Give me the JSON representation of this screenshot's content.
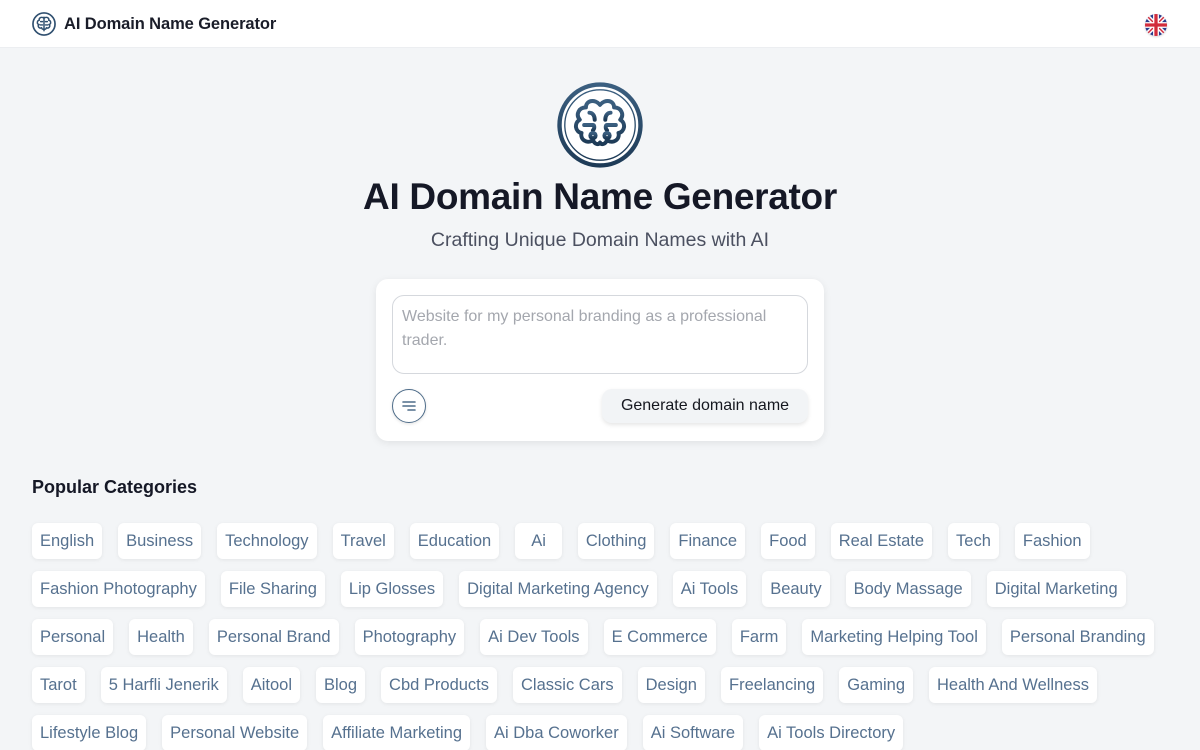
{
  "header": {
    "brand_title": "AI Domain Name Generator",
    "brand_icon": "brain-logo-icon",
    "language_icon": "uk-flag-icon"
  },
  "hero": {
    "logo_icon": "brain-logo-icon",
    "title": "AI Domain Name Generator",
    "subtitle": "Crafting Unique Domain Names with AI"
  },
  "generator": {
    "prompt_value": "",
    "prompt_placeholder": "Website for my personal branding as a professional trader.",
    "options_icon": "filter-lines-icon",
    "generate_label": "Generate domain name"
  },
  "categories": {
    "title": "Popular Categories",
    "items": [
      "English",
      "Business",
      "Technology",
      "Travel",
      "Education",
      "Ai",
      "Clothing",
      "Finance",
      "Food",
      "Real Estate",
      "Tech",
      "Fashion",
      "Fashion Photography",
      "File Sharing",
      "Lip Glosses",
      "Digital Marketing Agency",
      "Ai Tools",
      "Beauty",
      "Body Massage",
      "Digital Marketing",
      "Personal",
      "Health",
      "Personal Brand",
      "Photography",
      "Ai Dev Tools",
      "E Commerce",
      "Farm",
      "Marketing Helping Tool",
      "Personal Branding",
      "Tarot",
      "5 Harfli Jenerik",
      "Aitool",
      "Blog",
      "Cbd Products",
      "Classic Cars",
      "Design",
      "Freelancing",
      "Gaming",
      "Health And Wellness",
      "Lifestyle Blog",
      "Personal Website",
      "Affiliate Marketing",
      "Ai Dba Coworker",
      "Ai Software",
      "Ai Tools Directory"
    ]
  },
  "colors": {
    "accent": "#2f4f6f",
    "chip_text": "#56718f",
    "background": "#f3f5f7"
  }
}
